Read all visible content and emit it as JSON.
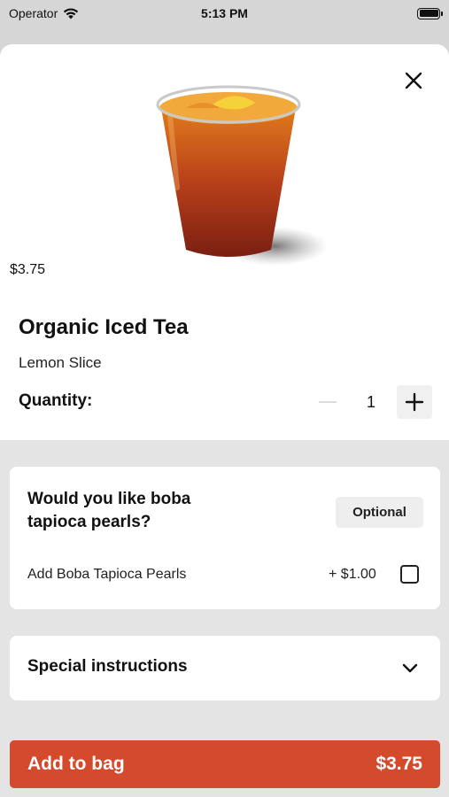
{
  "status_bar": {
    "carrier": "Operator",
    "time": "5:13 PM"
  },
  "product": {
    "price": "$3.75",
    "title": "Organic Iced Tea",
    "description": "Lemon Slice",
    "image_icon": "iced-tea-cup"
  },
  "quantity": {
    "label": "Quantity:",
    "value": "1"
  },
  "boba": {
    "question": "Would you like boba tapioca pearls?",
    "badge": "Optional",
    "option_label": "Add Boba Tapioca Pearls",
    "option_price": "+ $1.00",
    "checked": false
  },
  "instructions": {
    "label": "Special instructions"
  },
  "cta": {
    "label": "Add to bag",
    "price": "$3.75",
    "color": "#d44a2c"
  }
}
